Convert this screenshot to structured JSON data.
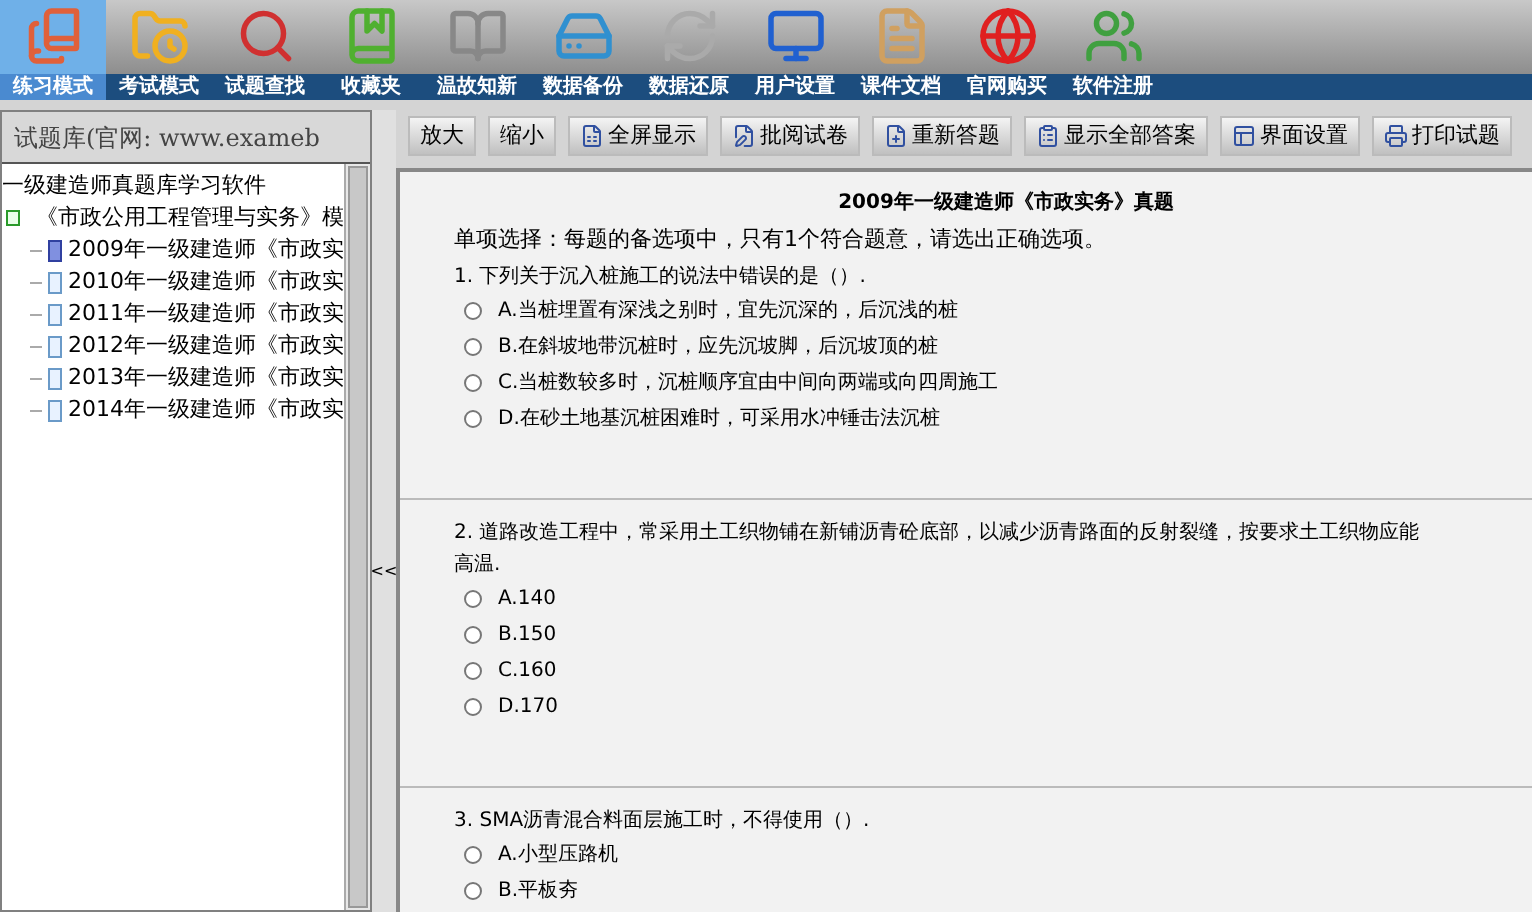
{
  "toolbar": [
    {
      "label": "练习模式",
      "selected": true
    },
    {
      "label": "考试模式",
      "selected": false
    },
    {
      "label": "试题查找",
      "selected": false
    },
    {
      "label": "收藏夹",
      "selected": false
    },
    {
      "label": "温故知新",
      "selected": false
    },
    {
      "label": "数据备份",
      "selected": false
    },
    {
      "label": "数据还原",
      "selected": false
    },
    {
      "label": "用户设置",
      "selected": false
    },
    {
      "label": "课件文档",
      "selected": false
    },
    {
      "label": "官网购买",
      "selected": false
    },
    {
      "label": "软件注册",
      "selected": false
    }
  ],
  "sidebar": {
    "header": "试题库(官网: www.exameb",
    "tree": {
      "label": "一级建造师真题库学习软件",
      "children": [
        {
          "label": "《市政公用工程管理与实务》模",
          "expanded": true,
          "children": [
            {
              "label": "2009年一级建造师《市政实",
              "selected": true
            },
            {
              "label": "2010年一级建造师《市政实",
              "selected": false
            },
            {
              "label": "2011年一级建造师《市政实",
              "selected": false
            },
            {
              "label": "2012年一级建造师《市政实",
              "selected": false
            },
            {
              "label": "2013年一级建造师《市政实",
              "selected": false
            },
            {
              "label": "2014年一级建造师《市政实",
              "selected": false
            }
          ]
        }
      ]
    }
  },
  "splitter": {
    "label": "<<"
  },
  "buttons": [
    {
      "label": "放大",
      "kind": "text"
    },
    {
      "label": "缩小",
      "kind": "text"
    },
    {
      "label": "全屏显示",
      "kind": "icon"
    },
    {
      "label": "批阅试卷",
      "kind": "icon"
    },
    {
      "label": "重新答题",
      "kind": "icon"
    },
    {
      "label": "显示全部答案",
      "kind": "icon"
    },
    {
      "label": "界面设置",
      "kind": "icon"
    },
    {
      "label": "打印试题",
      "kind": "icon"
    }
  ],
  "paper": {
    "title": "2009年一级建造师《市政实务》真题",
    "instructions": "单项选择：每题的备选项中，只有1个符合题意，请选出正确选项。",
    "questions": [
      {
        "text": "1. 下列关于沉入桩施工的说法中错误的是（）.",
        "options": [
          {
            "label": "A.当桩埋置有深浅之别时，宜先沉深的，后沉浅的桩",
            "selected": false
          },
          {
            "label": "B.在斜坡地带沉桩时，应先沉坡脚，后沉坡顶的桩",
            "selected": false
          },
          {
            "label": "C.当桩数较多时，沉桩顺序宜由中间向两端或向四周施工",
            "selected": false
          },
          {
            "label": "D.在砂土地基沉桩困难时，可采用水冲锤击法沉桩",
            "selected": false
          }
        ]
      },
      {
        "text": "2. 道路改造工程中，常采用土工织物铺在新铺沥青砼底部，以减少沥青路面的反射裂缝，按要求土工织物应能",
        "text_line_2": "高温.",
        "options": [
          {
            "label": "A.140",
            "selected": false
          },
          {
            "label": "B.150",
            "selected": false
          },
          {
            "label": "C.160",
            "selected": false
          },
          {
            "label": "D.170",
            "selected": false
          }
        ]
      },
      {
        "text": "3. SMA沥青混合料面层施工时，不得使用（）.",
        "options": [
          {
            "label": "A.小型压路机",
            "selected": false
          },
          {
            "label": "B.平板夯",
            "selected": false
          }
        ]
      }
    ]
  }
}
